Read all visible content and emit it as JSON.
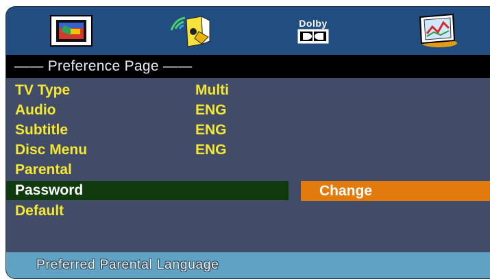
{
  "tabs": [
    {
      "name": "general-setup",
      "icon": "tv-screen-icon"
    },
    {
      "name": "audio-setup",
      "icon": "speaker-icon"
    },
    {
      "name": "dolby-setup",
      "icon": "dolby-icon",
      "label": "Dolby"
    },
    {
      "name": "preference-setup",
      "icon": "chart-board-icon"
    }
  ],
  "header": {
    "title": "—— Preference Page ——"
  },
  "menu": {
    "items": [
      {
        "label": "TV Type",
        "value": "Multi"
      },
      {
        "label": "Audio",
        "value": "ENG"
      },
      {
        "label": "Subtitle",
        "value": "ENG"
      },
      {
        "label": "Disc Menu",
        "value": "ENG"
      },
      {
        "label": "Parental",
        "value": ""
      },
      {
        "label": "Password",
        "value": ""
      },
      {
        "label": "Default",
        "value": ""
      }
    ],
    "selected": "Password",
    "submenu_option": "Change"
  },
  "status": {
    "text": "Preferred Parental Language"
  },
  "colors": {
    "background": "#414d68",
    "topbar": "#214d80",
    "header": "#000000",
    "item_text": "#f6e832",
    "selected_row": "#0e3a0d",
    "submenu": "#e27a0c",
    "status_bar": "#5fa2c3"
  }
}
